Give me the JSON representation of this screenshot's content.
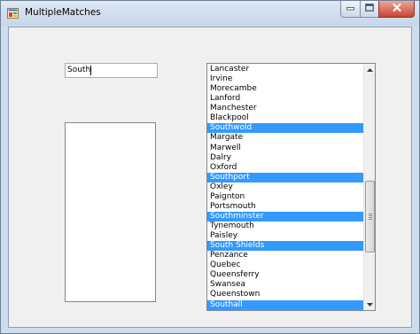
{
  "window": {
    "title": "MultipleMatches"
  },
  "search": {
    "value": "South"
  },
  "cities": {
    "items": [
      {
        "label": "Lancaster",
        "selected": false
      },
      {
        "label": "Irvine",
        "selected": false
      },
      {
        "label": "Morecambe",
        "selected": false
      },
      {
        "label": "Lanford",
        "selected": false
      },
      {
        "label": "Manchester",
        "selected": false
      },
      {
        "label": "Blackpool",
        "selected": false
      },
      {
        "label": "Southwold",
        "selected": true
      },
      {
        "label": "Margate",
        "selected": false
      },
      {
        "label": "Marwell",
        "selected": false
      },
      {
        "label": "Dalry",
        "selected": false
      },
      {
        "label": "Oxford",
        "selected": false
      },
      {
        "label": "Southport",
        "selected": true
      },
      {
        "label": "Oxley",
        "selected": false
      },
      {
        "label": "Paignton",
        "selected": false
      },
      {
        "label": "Portsmouth",
        "selected": false
      },
      {
        "label": "Southminster",
        "selected": true
      },
      {
        "label": "Tynemouth",
        "selected": false
      },
      {
        "label": "Paisley",
        "selected": false
      },
      {
        "label": "South Shields",
        "selected": true
      },
      {
        "label": "Penzance",
        "selected": false
      },
      {
        "label": "Quebec",
        "selected": false
      },
      {
        "label": "Queensferry",
        "selected": false
      },
      {
        "label": "Swansea",
        "selected": false
      },
      {
        "label": "Queenstown",
        "selected": false
      },
      {
        "label": "Southall",
        "selected": true
      }
    ]
  },
  "colors": {
    "selection": "#3399ff",
    "selection_text": "#ffffff",
    "close_button": "#c8452f"
  },
  "icons": {
    "app": "app-icon",
    "minimize": "minimize-icon",
    "maximize": "maximize-icon",
    "close": "close-icon",
    "scroll_up": "arrow-up-icon",
    "scroll_down": "arrow-down-icon"
  }
}
